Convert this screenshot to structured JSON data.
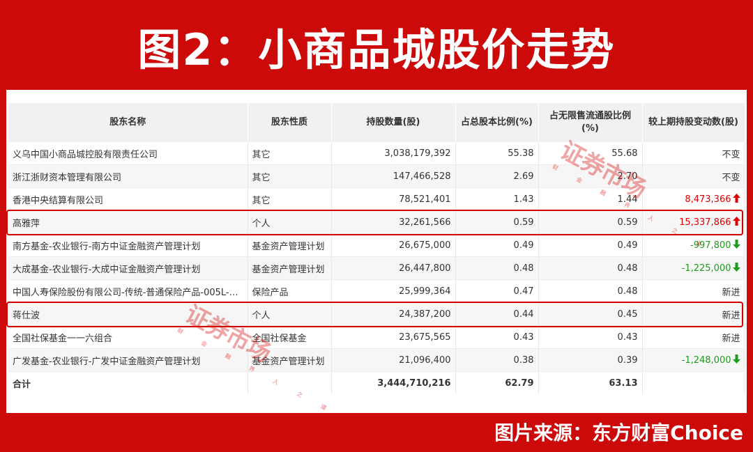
{
  "title": "图2：小商品城股价走势",
  "source": "图片来源：东方财富Choice",
  "watermark": {
    "main": "证券市场",
    "sub": "WEEKLY",
    "tagline": "财 金 融 界 人 之 道"
  },
  "colors": {
    "frame": "#cc0a0a",
    "up": "#e00000",
    "down": "#1c9b1c",
    "highlight": "#d40000"
  },
  "table": {
    "headers": [
      "股东名称",
      "股东性质",
      "持股数量(股)",
      "占总股本比例(%)",
      "占无限售流通股比例(%)",
      "较上期持股变动数(股)"
    ],
    "rows": [
      {
        "name": "义乌中国小商品城控股有限责任公司",
        "type": "其它",
        "shares": "3,038,179,392",
        "pct_total": "55.38",
        "pct_float": "55.68",
        "change": "不变",
        "dir": "none"
      },
      {
        "name": "浙江浙财资本管理有限公司",
        "type": "其它",
        "shares": "147,466,528",
        "pct_total": "2.69",
        "pct_float": "2.70",
        "change": "不变",
        "dir": "none"
      },
      {
        "name": "香港中央结算有限公司",
        "type": "其它",
        "shares": "78,521,401",
        "pct_total": "1.43",
        "pct_float": "1.44",
        "change": "8,473,366",
        "dir": "up"
      },
      {
        "name": "高雅萍",
        "type": "个人",
        "shares": "32,261,566",
        "pct_total": "0.59",
        "pct_float": "0.59",
        "change": "15,337,866",
        "dir": "up"
      },
      {
        "name": "南方基金-农业银行-南方中证金融资产管理计划",
        "type": "基金资产管理计划",
        "shares": "26,675,000",
        "pct_total": "0.49",
        "pct_float": "0.49",
        "change": "-997,800",
        "dir": "down"
      },
      {
        "name": "大成基金-农业银行-大成中证金融资产管理计划",
        "type": "基金资产管理计划",
        "shares": "26,447,800",
        "pct_total": "0.48",
        "pct_float": "0.48",
        "change": "-1,225,000",
        "dir": "down"
      },
      {
        "name": "中国人寿保险股份有限公司-传统-普通保险产品-005L-CT...",
        "type": "保险产品",
        "shares": "25,999,364",
        "pct_total": "0.47",
        "pct_float": "0.48",
        "change": "新进",
        "dir": "none"
      },
      {
        "name": "蒋仕波",
        "type": "个人",
        "shares": "24,387,200",
        "pct_total": "0.44",
        "pct_float": "0.45",
        "change": "新进",
        "dir": "none"
      },
      {
        "name": "全国社保基金一一六组合",
        "type": "全国社保基金",
        "shares": "23,675,565",
        "pct_total": "0.43",
        "pct_float": "0.43",
        "change": "新进",
        "dir": "none"
      },
      {
        "name": "广发基金-农业银行-广发中证金融资产管理计划",
        "type": "基金资产管理计划",
        "shares": "21,096,400",
        "pct_total": "0.38",
        "pct_float": "0.39",
        "change": "-1,248,000",
        "dir": "down"
      }
    ],
    "total": {
      "name": "合计",
      "type": "",
      "shares": "3,444,710,216",
      "pct_total": "62.79",
      "pct_float": "63.13",
      "change": ""
    },
    "highlighted_rows": [
      3,
      7
    ]
  }
}
